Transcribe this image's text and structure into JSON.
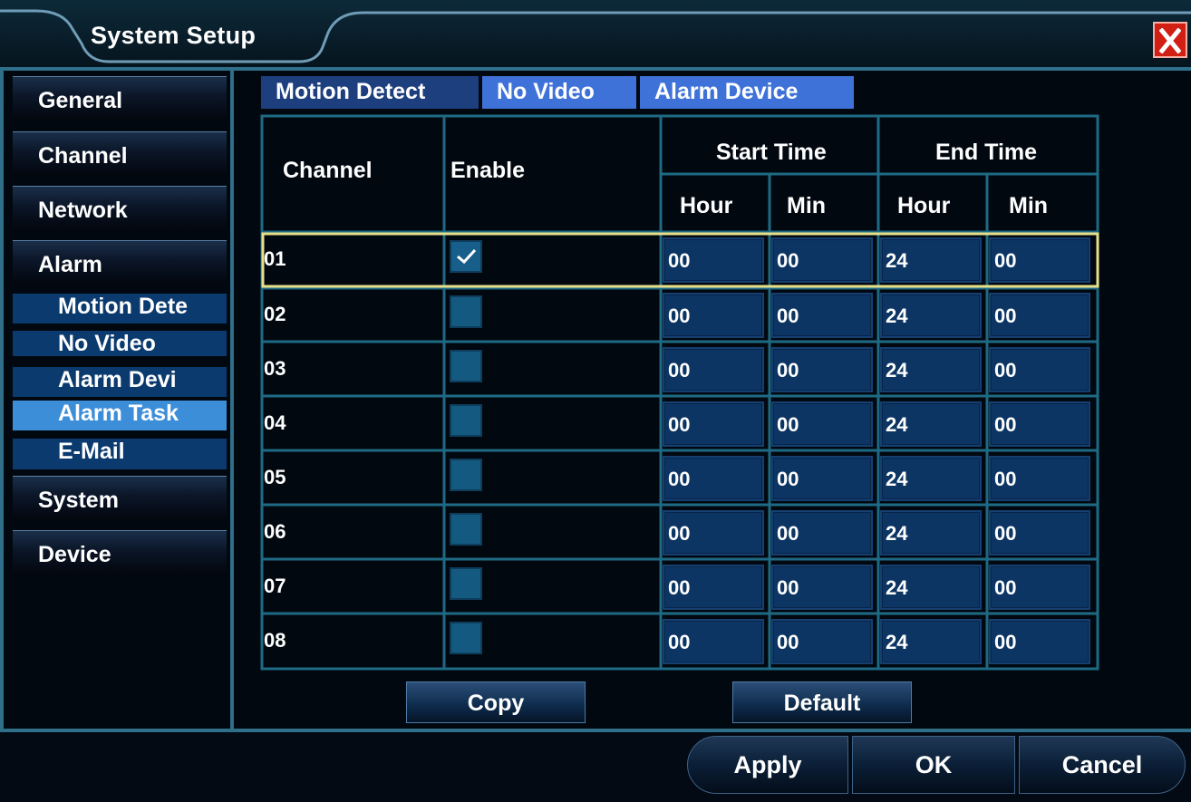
{
  "window": {
    "title": "System Setup"
  },
  "sidebar": {
    "items": [
      {
        "label": "General"
      },
      {
        "label": "Channel"
      },
      {
        "label": "Network"
      },
      {
        "label": "Alarm"
      },
      {
        "label": "System"
      },
      {
        "label": "Device"
      }
    ],
    "alarm_subitems": [
      {
        "label": "Motion Dete"
      },
      {
        "label": "No Video"
      },
      {
        "label": "Alarm Devi"
      },
      {
        "label": "Alarm Task"
      },
      {
        "label": "E-Mail"
      }
    ]
  },
  "tabs": [
    {
      "label": "Motion Detect"
    },
    {
      "label": "No Video"
    },
    {
      "label": "Alarm Device"
    }
  ],
  "table": {
    "headers": {
      "channel": "Channel",
      "enable": "Enable",
      "start_time": "Start Time",
      "end_time": "End Time",
      "start_hour": "Hour",
      "start_min": "Min",
      "end_hour": "Hour",
      "end_min": "Min"
    },
    "rows": [
      {
        "channel": "01",
        "enabled": true,
        "start_hour": "00",
        "start_min": "00",
        "end_hour": "24",
        "end_min": "00"
      },
      {
        "channel": "02",
        "enabled": false,
        "start_hour": "00",
        "start_min": "00",
        "end_hour": "24",
        "end_min": "00"
      },
      {
        "channel": "03",
        "enabled": false,
        "start_hour": "00",
        "start_min": "00",
        "end_hour": "24",
        "end_min": "00"
      },
      {
        "channel": "04",
        "enabled": false,
        "start_hour": "00",
        "start_min": "00",
        "end_hour": "24",
        "end_min": "00"
      },
      {
        "channel": "05",
        "enabled": false,
        "start_hour": "00",
        "start_min": "00",
        "end_hour": "24",
        "end_min": "00"
      },
      {
        "channel": "06",
        "enabled": false,
        "start_hour": "00",
        "start_min": "00",
        "end_hour": "24",
        "end_min": "00"
      },
      {
        "channel": "07",
        "enabled": false,
        "start_hour": "00",
        "start_min": "00",
        "end_hour": "24",
        "end_min": "00"
      },
      {
        "channel": "08",
        "enabled": false,
        "start_hour": "00",
        "start_min": "00",
        "end_hour": "24",
        "end_min": "00"
      }
    ]
  },
  "buttons": {
    "copy": "Copy",
    "default": "Default",
    "apply": "Apply",
    "ok": "OK",
    "cancel": "Cancel"
  },
  "colors": {
    "accent_blue": "#3f72d8",
    "highlight_row": "#e6e08a",
    "close_red": "#d21f14"
  }
}
